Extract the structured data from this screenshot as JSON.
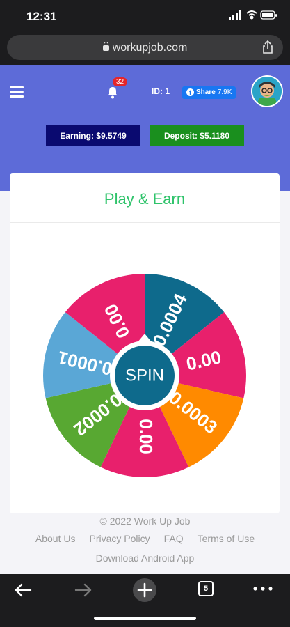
{
  "status": {
    "time": "12:31"
  },
  "browser": {
    "url": "workupjob.com",
    "tab_count": "5"
  },
  "header": {
    "notification_count": "32",
    "user_id": "ID: 1",
    "share_label": "Share",
    "share_count": "7.9K",
    "earning": "Earning: $9.5749",
    "deposit": "Deposit: $5.1180"
  },
  "game": {
    "title": "Play & Earn",
    "spin_label": "SPIN",
    "segments": [
      {
        "label": "0.0004",
        "color": "#0e6a8c"
      },
      {
        "label": "0.00",
        "color": "#e8206c"
      },
      {
        "label": "0.0003",
        "color": "#ff8a00"
      },
      {
        "label": "0.00",
        "color": "#e8206c"
      },
      {
        "label": "0.0002",
        "color": "#58a832"
      },
      {
        "label": "0.0001",
        "color": "#5aa7d6"
      },
      {
        "label": "0.00",
        "color": "#e8206c"
      }
    ]
  },
  "footer": {
    "copyright": "© 2022 Work Up Job",
    "links": [
      "About Us",
      "Privacy Policy",
      "FAQ",
      "Terms of Use"
    ],
    "download": "Download Android App"
  }
}
